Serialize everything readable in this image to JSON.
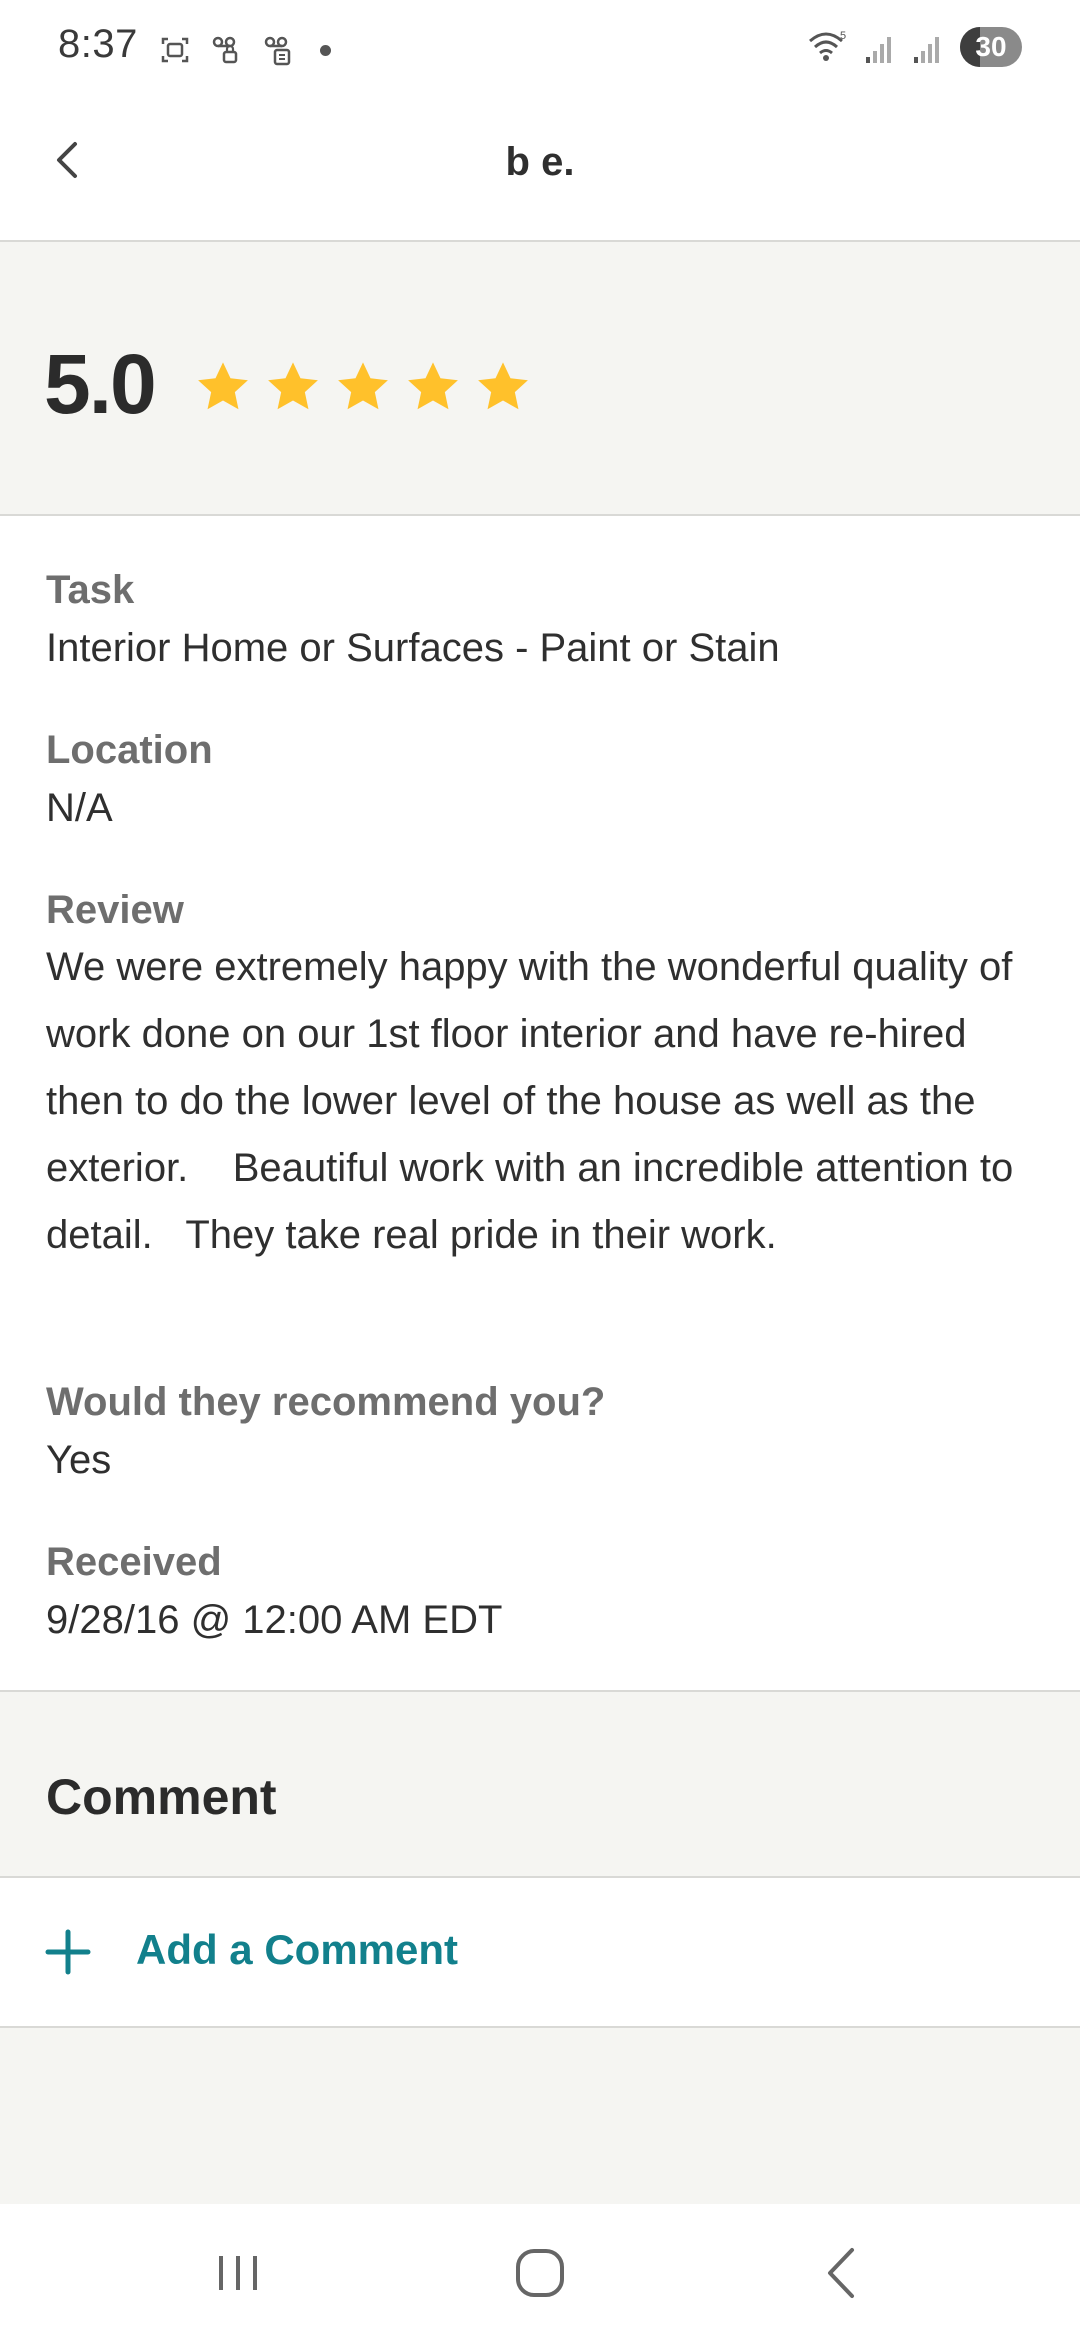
{
  "status_bar": {
    "time": "8:37",
    "battery": "30",
    "icons": [
      "screenshot-icon",
      "voicemail-lock-icon",
      "voicemail-lock-icon",
      "notification-dot-icon",
      "wifi-icon",
      "signal-icon",
      "signal-icon",
      "battery-icon"
    ]
  },
  "header": {
    "title": "b e.",
    "back_icon": "chevron-left-icon"
  },
  "rating": {
    "value": "5.0",
    "stars": 5,
    "max_stars": 5,
    "star_color": "#FFC12B"
  },
  "details": {
    "task": {
      "label": "Task",
      "value": "Interior Home or Surfaces - Paint or Stain"
    },
    "location": {
      "label": "Location",
      "value": "N/A"
    },
    "review": {
      "label": "Review",
      "value": "We were extremely happy with the wonderful quality of work done on our 1st floor interior and have re-hired then to do the lower level of the house as well as the exterior.    Beautiful work with an incredible attention to detail.   They take real pride in their work."
    },
    "recommend": {
      "label": "Would they recommend you?",
      "value": "Yes"
    },
    "received": {
      "label": "Received",
      "value": "9/28/16 @ 12:00 AM EDT"
    }
  },
  "comment": {
    "title": "Comment",
    "add_label": "Add a Comment",
    "accent_color": "#12808C"
  },
  "nav_bar": {
    "icons": [
      "recent-apps-icon",
      "home-icon",
      "back-icon"
    ]
  }
}
